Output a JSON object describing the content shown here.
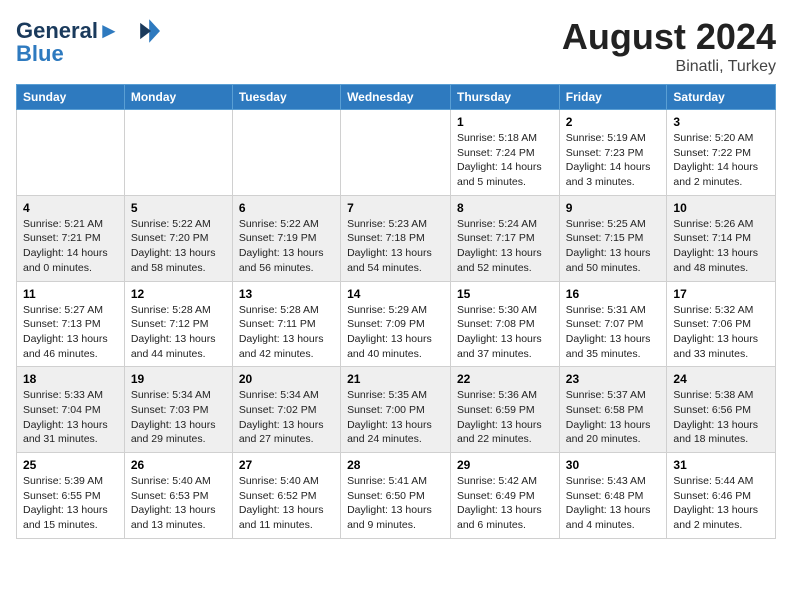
{
  "header": {
    "logo_line1": "General",
    "logo_line2": "Blue",
    "month": "August 2024",
    "location": "Binatli, Turkey"
  },
  "weekdays": [
    "Sunday",
    "Monday",
    "Tuesday",
    "Wednesday",
    "Thursday",
    "Friday",
    "Saturday"
  ],
  "rows": [
    [
      {
        "day": "",
        "lines": []
      },
      {
        "day": "",
        "lines": []
      },
      {
        "day": "",
        "lines": []
      },
      {
        "day": "",
        "lines": []
      },
      {
        "day": "1",
        "lines": [
          "Sunrise: 5:18 AM",
          "Sunset: 7:24 PM",
          "Daylight: 14 hours",
          "and 5 minutes."
        ]
      },
      {
        "day": "2",
        "lines": [
          "Sunrise: 5:19 AM",
          "Sunset: 7:23 PM",
          "Daylight: 14 hours",
          "and 3 minutes."
        ]
      },
      {
        "day": "3",
        "lines": [
          "Sunrise: 5:20 AM",
          "Sunset: 7:22 PM",
          "Daylight: 14 hours",
          "and 2 minutes."
        ]
      }
    ],
    [
      {
        "day": "4",
        "lines": [
          "Sunrise: 5:21 AM",
          "Sunset: 7:21 PM",
          "Daylight: 14 hours",
          "and 0 minutes."
        ]
      },
      {
        "day": "5",
        "lines": [
          "Sunrise: 5:22 AM",
          "Sunset: 7:20 PM",
          "Daylight: 13 hours",
          "and 58 minutes."
        ]
      },
      {
        "day": "6",
        "lines": [
          "Sunrise: 5:22 AM",
          "Sunset: 7:19 PM",
          "Daylight: 13 hours",
          "and 56 minutes."
        ]
      },
      {
        "day": "7",
        "lines": [
          "Sunrise: 5:23 AM",
          "Sunset: 7:18 PM",
          "Daylight: 13 hours",
          "and 54 minutes."
        ]
      },
      {
        "day": "8",
        "lines": [
          "Sunrise: 5:24 AM",
          "Sunset: 7:17 PM",
          "Daylight: 13 hours",
          "and 52 minutes."
        ]
      },
      {
        "day": "9",
        "lines": [
          "Sunrise: 5:25 AM",
          "Sunset: 7:15 PM",
          "Daylight: 13 hours",
          "and 50 minutes."
        ]
      },
      {
        "day": "10",
        "lines": [
          "Sunrise: 5:26 AM",
          "Sunset: 7:14 PM",
          "Daylight: 13 hours",
          "and 48 minutes."
        ]
      }
    ],
    [
      {
        "day": "11",
        "lines": [
          "Sunrise: 5:27 AM",
          "Sunset: 7:13 PM",
          "Daylight: 13 hours",
          "and 46 minutes."
        ]
      },
      {
        "day": "12",
        "lines": [
          "Sunrise: 5:28 AM",
          "Sunset: 7:12 PM",
          "Daylight: 13 hours",
          "and 44 minutes."
        ]
      },
      {
        "day": "13",
        "lines": [
          "Sunrise: 5:28 AM",
          "Sunset: 7:11 PM",
          "Daylight: 13 hours",
          "and 42 minutes."
        ]
      },
      {
        "day": "14",
        "lines": [
          "Sunrise: 5:29 AM",
          "Sunset: 7:09 PM",
          "Daylight: 13 hours",
          "and 40 minutes."
        ]
      },
      {
        "day": "15",
        "lines": [
          "Sunrise: 5:30 AM",
          "Sunset: 7:08 PM",
          "Daylight: 13 hours",
          "and 37 minutes."
        ]
      },
      {
        "day": "16",
        "lines": [
          "Sunrise: 5:31 AM",
          "Sunset: 7:07 PM",
          "Daylight: 13 hours",
          "and 35 minutes."
        ]
      },
      {
        "day": "17",
        "lines": [
          "Sunrise: 5:32 AM",
          "Sunset: 7:06 PM",
          "Daylight: 13 hours",
          "and 33 minutes."
        ]
      }
    ],
    [
      {
        "day": "18",
        "lines": [
          "Sunrise: 5:33 AM",
          "Sunset: 7:04 PM",
          "Daylight: 13 hours",
          "and 31 minutes."
        ]
      },
      {
        "day": "19",
        "lines": [
          "Sunrise: 5:34 AM",
          "Sunset: 7:03 PM",
          "Daylight: 13 hours",
          "and 29 minutes."
        ]
      },
      {
        "day": "20",
        "lines": [
          "Sunrise: 5:34 AM",
          "Sunset: 7:02 PM",
          "Daylight: 13 hours",
          "and 27 minutes."
        ]
      },
      {
        "day": "21",
        "lines": [
          "Sunrise: 5:35 AM",
          "Sunset: 7:00 PM",
          "Daylight: 13 hours",
          "and 24 minutes."
        ]
      },
      {
        "day": "22",
        "lines": [
          "Sunrise: 5:36 AM",
          "Sunset: 6:59 PM",
          "Daylight: 13 hours",
          "and 22 minutes."
        ]
      },
      {
        "day": "23",
        "lines": [
          "Sunrise: 5:37 AM",
          "Sunset: 6:58 PM",
          "Daylight: 13 hours",
          "and 20 minutes."
        ]
      },
      {
        "day": "24",
        "lines": [
          "Sunrise: 5:38 AM",
          "Sunset: 6:56 PM",
          "Daylight: 13 hours",
          "and 18 minutes."
        ]
      }
    ],
    [
      {
        "day": "25",
        "lines": [
          "Sunrise: 5:39 AM",
          "Sunset: 6:55 PM",
          "Daylight: 13 hours",
          "and 15 minutes."
        ]
      },
      {
        "day": "26",
        "lines": [
          "Sunrise: 5:40 AM",
          "Sunset: 6:53 PM",
          "Daylight: 13 hours",
          "and 13 minutes."
        ]
      },
      {
        "day": "27",
        "lines": [
          "Sunrise: 5:40 AM",
          "Sunset: 6:52 PM",
          "Daylight: 13 hours",
          "and 11 minutes."
        ]
      },
      {
        "day": "28",
        "lines": [
          "Sunrise: 5:41 AM",
          "Sunset: 6:50 PM",
          "Daylight: 13 hours",
          "and 9 minutes."
        ]
      },
      {
        "day": "29",
        "lines": [
          "Sunrise: 5:42 AM",
          "Sunset: 6:49 PM",
          "Daylight: 13 hours",
          "and 6 minutes."
        ]
      },
      {
        "day": "30",
        "lines": [
          "Sunrise: 5:43 AM",
          "Sunset: 6:48 PM",
          "Daylight: 13 hours",
          "and 4 minutes."
        ]
      },
      {
        "day": "31",
        "lines": [
          "Sunrise: 5:44 AM",
          "Sunset: 6:46 PM",
          "Daylight: 13 hours",
          "and 2 minutes."
        ]
      }
    ]
  ]
}
